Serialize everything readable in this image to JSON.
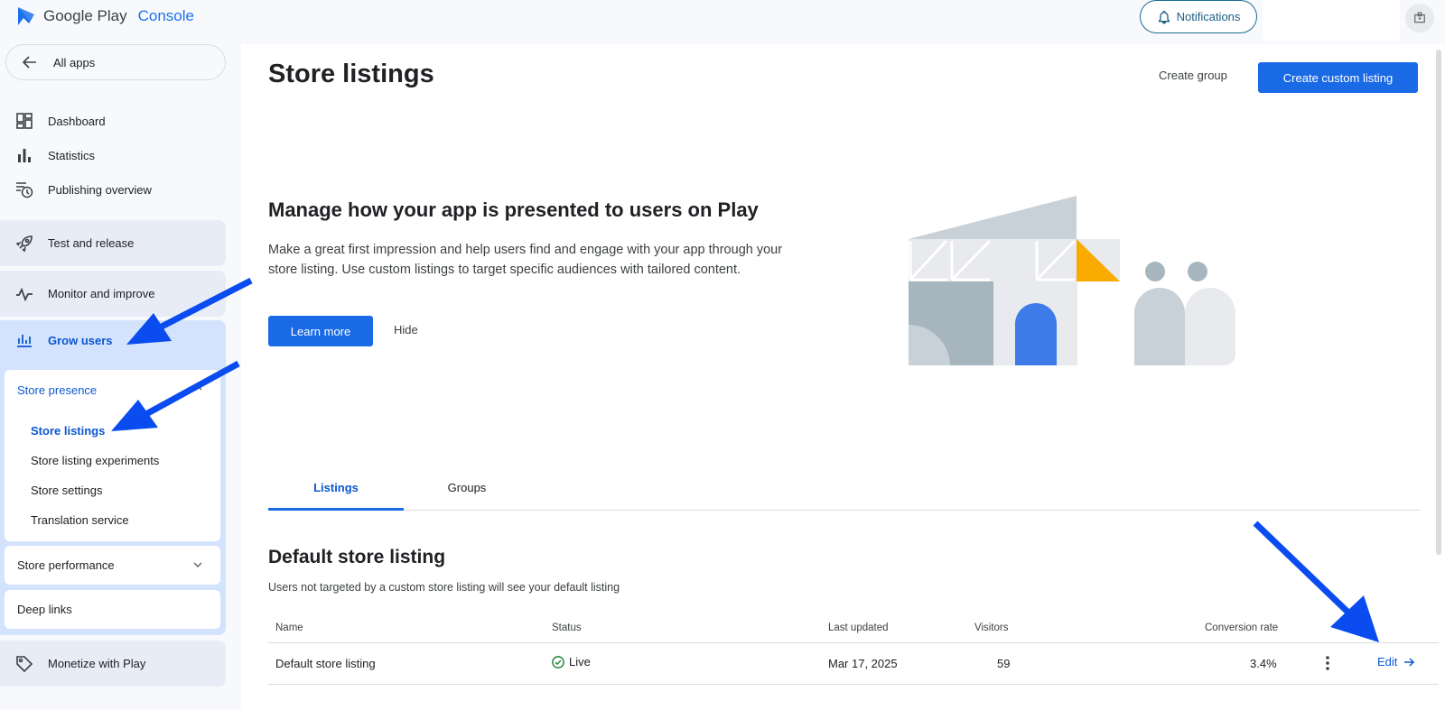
{
  "header": {
    "logo_google_play": "Google Play",
    "logo_console": "Console",
    "notifications_label": "Notifications"
  },
  "sidebar": {
    "all_apps": "All apps",
    "items": [
      {
        "label": "Dashboard",
        "icon": "dashboard-icon"
      },
      {
        "label": "Statistics",
        "icon": "bar-chart-icon"
      },
      {
        "label": "Publishing overview",
        "icon": "publishing-icon"
      }
    ],
    "groups": {
      "test_release": "Test and release",
      "monitor_improve": "Monitor and improve",
      "grow_users": "Grow users",
      "monetize": "Monetize with Play"
    },
    "store_presence": {
      "title": "Store presence",
      "items": [
        "Store listings",
        "Store listing experiments",
        "Store settings",
        "Translation service"
      ],
      "active_index": 0
    },
    "store_performance": "Store performance",
    "deep_links": "Deep links"
  },
  "main": {
    "title": "Store listings",
    "create_group": "Create group",
    "create_custom_listing": "Create custom listing",
    "hero": {
      "title": "Manage how your app is presented to users on Play",
      "description": "Make a great first impression and help users find and engage with your app through your store listing. Use custom listings to target specific audiences with tailored content.",
      "learn_more": "Learn more",
      "hide": "Hide"
    },
    "tabs": [
      {
        "label": "Listings",
        "active": true
      },
      {
        "label": "Groups",
        "active": false
      }
    ],
    "default_section": {
      "title": "Default store listing",
      "description": "Users not targeted by a custom store listing will see your default listing"
    },
    "table": {
      "columns": [
        "Name",
        "Status",
        "Last updated",
        "Visitors",
        "Conversion rate"
      ],
      "rows": [
        {
          "name": "Default store listing",
          "status": "Live",
          "last_updated": "Mar 17, 2025",
          "visitors": "59",
          "conversion_rate": "3.4%",
          "action": "Edit"
        }
      ]
    }
  },
  "colors": {
    "accent": "#1a6ae6",
    "active_text": "#0b57d0",
    "grow_block": "#d3e3fd",
    "annotation_arrow": "#0a4cf0",
    "live_green": "#188038"
  }
}
